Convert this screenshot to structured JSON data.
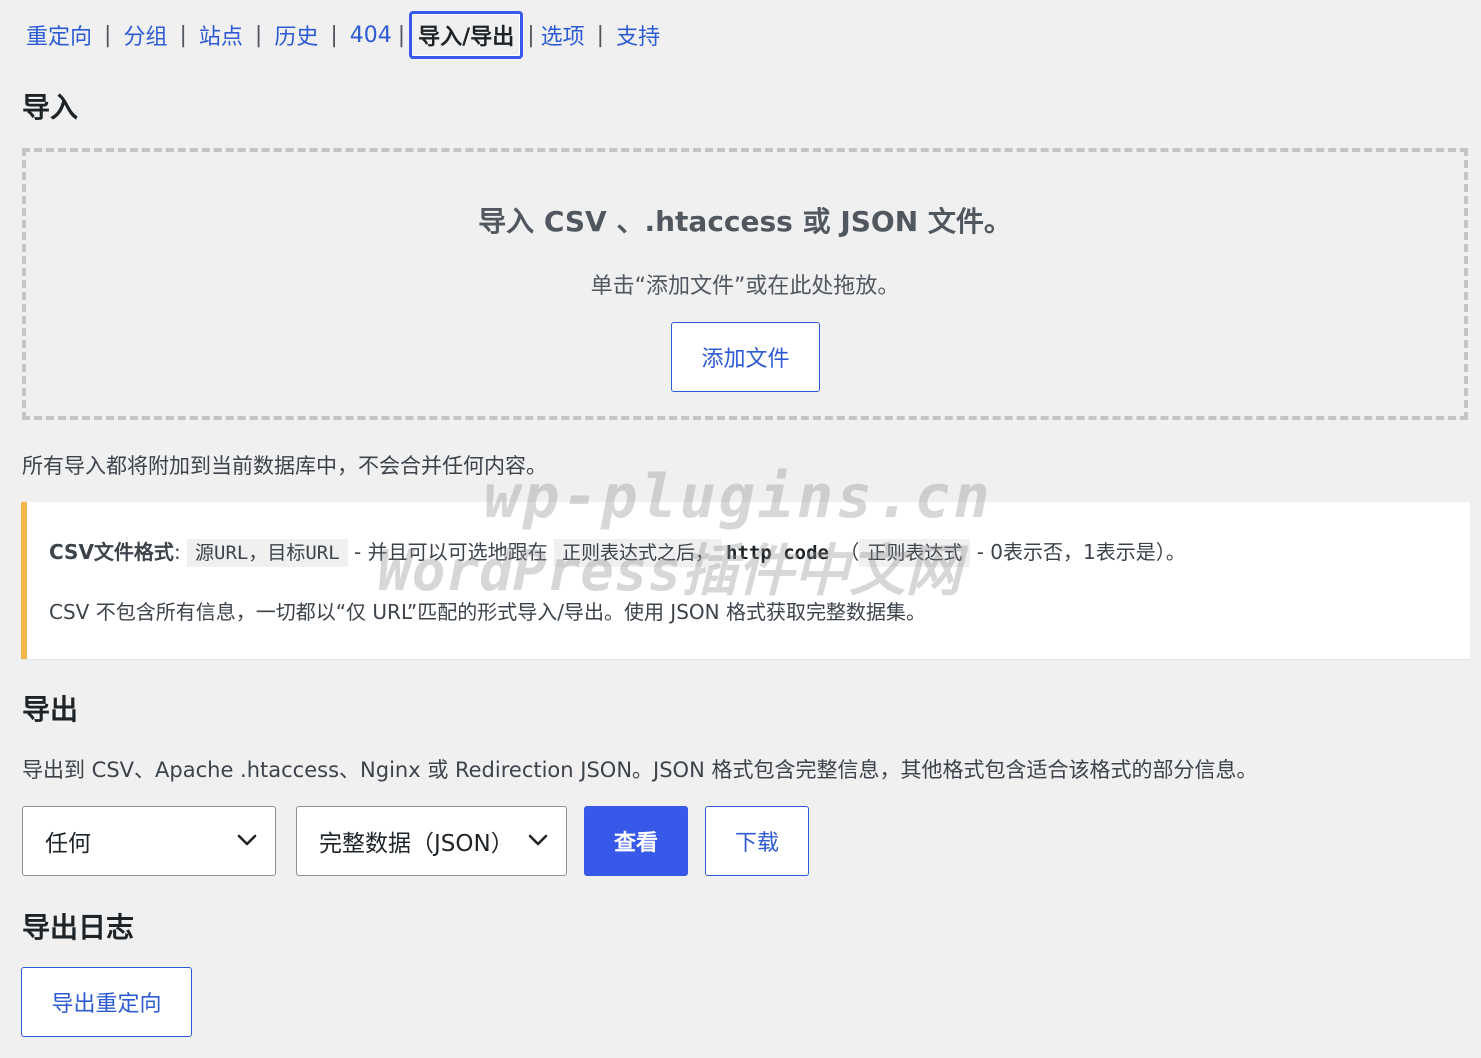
{
  "nav": {
    "items": [
      "重定向",
      "分组",
      "站点",
      "历史",
      "404",
      "导入/导出",
      "选项",
      "支持"
    ],
    "separator": "|"
  },
  "import": {
    "heading": "导入",
    "drop_title": "导入 CSV 、.htaccess 或 JSON 文件。",
    "drop_sub": "单击“添加文件”或在此处拖放。",
    "add_file_label": "添加文件",
    "note": "所有导入都将附加到当前数据库中，不会合并任何内容。"
  },
  "notice": {
    "format_label": "CSV文件格式",
    "colon": ":",
    "code_source": "源URL，目标URL",
    "text_mid": "- 并且可以可选地跟在",
    "code_regex": "正则表达式之后，",
    "code_http": "http code",
    "text_paren": "（",
    "code_regex2": "正则表达式",
    "text_end": "- 0表示否，1表示是）。",
    "line2": "CSV 不包含所有信息，一切都以“仅 URL”匹配的形式导入/导出。使用 JSON 格式获取完整数据集。"
  },
  "export": {
    "heading": "导出",
    "description": "导出到 CSV、Apache .htaccess、Nginx 或 Redirection JSON。JSON 格式包含完整信息，其他格式包含适合该格式的部分信息。",
    "scope_value": "任何",
    "format_value": "完整数据（JSON）",
    "view_label": "查看",
    "download_label": "下载"
  },
  "export_logs": {
    "heading": "导出日志",
    "button_label": "导出重定向"
  },
  "watermark": {
    "line1": "wp-plugins.cn",
    "line2": "WordPress插件中文网"
  },
  "colors": {
    "link": "#2d5bd3",
    "primary": "#3858e9",
    "notice_accent": "#f0b849",
    "background": "#f0f0f1"
  },
  "icons": {
    "select_arrow": "chevron-down-icon"
  }
}
